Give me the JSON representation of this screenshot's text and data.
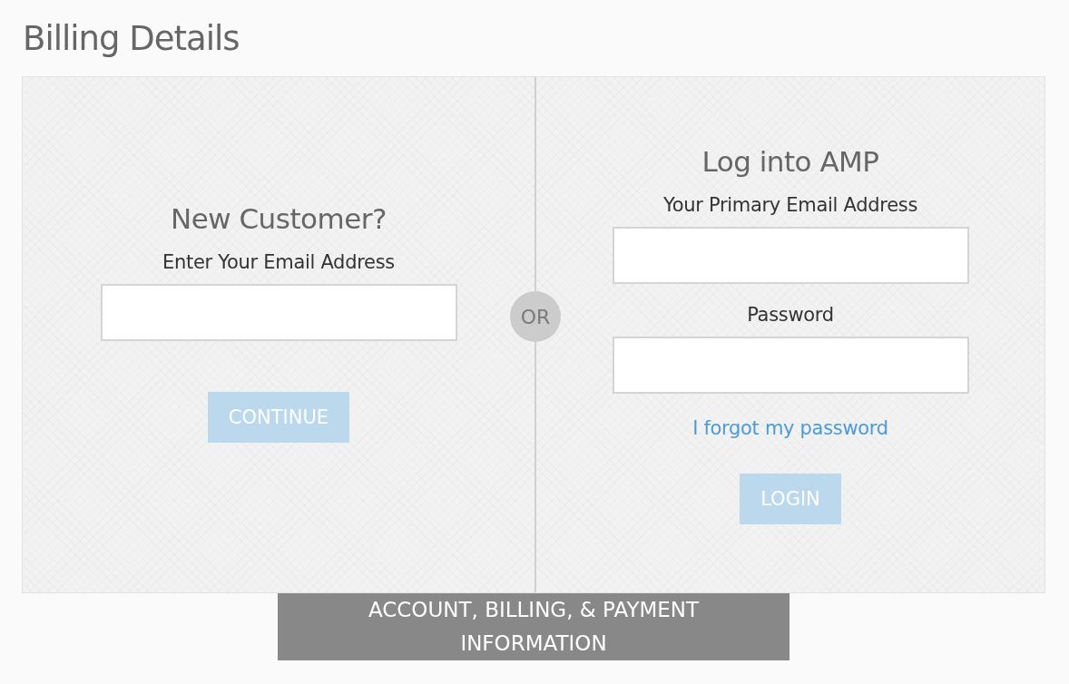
{
  "page_title": "Billing Details",
  "new_customer": {
    "heading": "New Customer?",
    "field_label": "Enter Your Email Address",
    "button": {
      "label": "CONTINUE",
      "disabled": true
    }
  },
  "separator": "OR",
  "login": {
    "heading": "Log into AMP",
    "fields": [
      {
        "label": "Your Primary Email Address"
      },
      {
        "label": "Password"
      }
    ],
    "forgot_link": "I forgot my password",
    "button": {
      "label": "LOGIN",
      "disabled": true
    }
  },
  "footer_banner": "ACCOUNT, BILLING, & PAYMENT INFORMATION"
}
